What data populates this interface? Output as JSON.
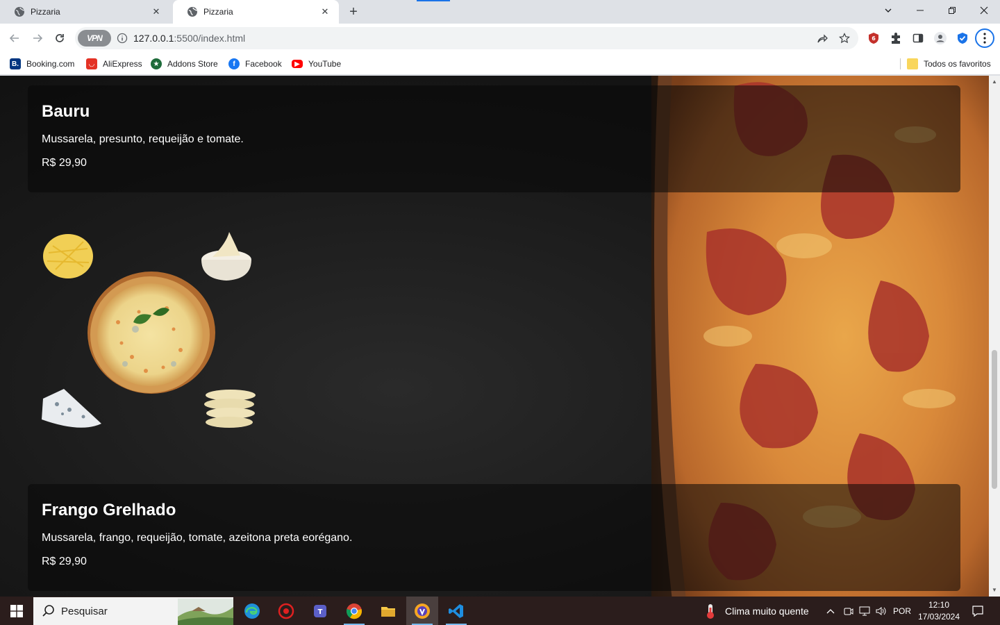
{
  "browser": {
    "tabs": [
      {
        "title": "Pizzaria",
        "active": false
      },
      {
        "title": "Pizzaria",
        "active": true
      }
    ],
    "url_host": "127.0.0.1",
    "url_rest": ":5500/index.html",
    "vpn_label": "VPN",
    "bookmarks": [
      {
        "label": "Booking.com",
        "icon": "booking-icon",
        "color": "#003580"
      },
      {
        "label": "AliExpress",
        "icon": "aliexpress-icon",
        "color": "#e43225"
      },
      {
        "label": "Addons Store",
        "icon": "addons-store-icon",
        "color": "#1e6b3a"
      },
      {
        "label": "Facebook",
        "icon": "facebook-icon",
        "color": "#1877f2"
      },
      {
        "label": "YouTube",
        "icon": "youtube-icon",
        "color": "#ff0000"
      }
    ],
    "all_bookmarks_label": "Todos os favoritos"
  },
  "page": {
    "menu_items": [
      {
        "name": "Bauru",
        "description": "Mussarela, presunto, requeijão e tomate.",
        "price": "R$ 29,90"
      },
      {
        "name": "Frango Grelhado",
        "description": "Mussarela, frango, requeijão, tomate, azeitona preta eorégano.",
        "price": "R$ 29,90"
      }
    ]
  },
  "taskbar": {
    "search_placeholder": "Pesquisar",
    "apps": [
      "edge-icon",
      "security-app-icon",
      "teams-icon",
      "chrome-icon",
      "file-explorer-icon",
      "vpn-browser-icon",
      "vscode-icon"
    ],
    "weather": "Clima muito quente",
    "language": "POR",
    "time": "12:10",
    "date": "17/03/2024"
  },
  "colors": {
    "accent": "#1a73e8",
    "page_bg": "#161616",
    "taskbar_bg": "#2b1d1c"
  }
}
